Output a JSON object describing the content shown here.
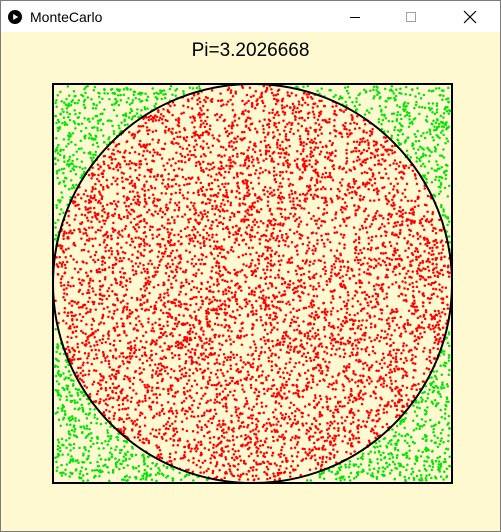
{
  "window": {
    "title": "MonteCarlo",
    "app_icon": "play-circle-icon",
    "buttons": [
      "minimize-icon",
      "maximize-icon",
      "close-icon"
    ]
  },
  "simulation": {
    "pi_label": "Pi=3.2026668"
  },
  "colors": {
    "background": "#fff9d2",
    "inside_points": "#ff0000",
    "outside_points": "#00e600",
    "outline": "#000000"
  }
}
